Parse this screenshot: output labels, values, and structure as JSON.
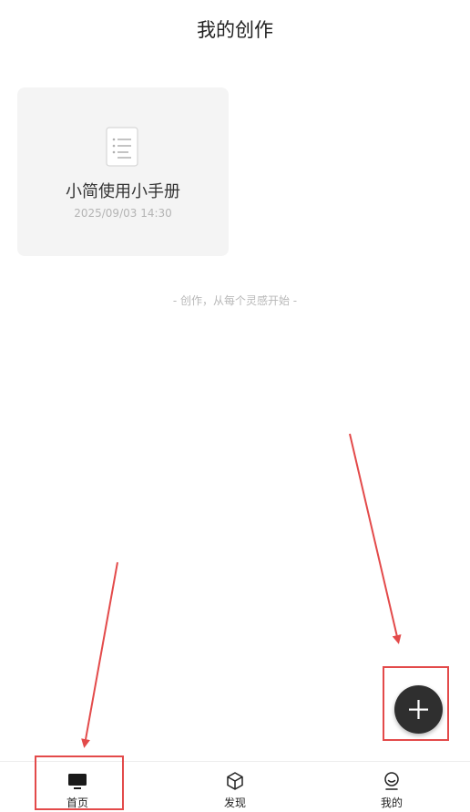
{
  "header": {
    "title": "我的创作"
  },
  "cards": [
    {
      "icon": "document-list-icon",
      "title": "小简使用小手册",
      "timestamp": "2025/09/03 14:30"
    }
  ],
  "hint": "- 创作，从每个灵感开始 -",
  "fab": {
    "icon": "plus-icon"
  },
  "tabbar": {
    "tabs": [
      {
        "label": "首页",
        "icon": "monitor-icon",
        "active": true
      },
      {
        "label": "发现",
        "icon": "cube-icon",
        "active": false
      },
      {
        "label": "我的",
        "icon": "user-icon",
        "active": false
      }
    ]
  },
  "annotations": {
    "color": "#e34a4a"
  }
}
